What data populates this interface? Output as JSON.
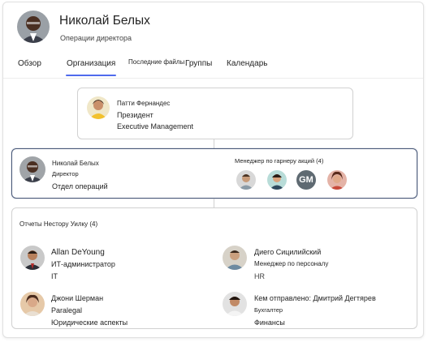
{
  "header": {
    "name": "Николай Белых",
    "subtitle": "Операции директора"
  },
  "tabs": [
    {
      "label": "Обзор"
    },
    {
      "label": "Организация"
    },
    {
      "label": "Последние файлы"
    },
    {
      "label": "Группы"
    },
    {
      "label": "Календарь"
    }
  ],
  "manager": {
    "name": "Патти Фернандес",
    "title": "Президент",
    "department": "Executive Management"
  },
  "current": {
    "name": "Николай Белых",
    "title": "Директор",
    "department": "Отдел операций",
    "peers_heading": "Менеджер по гарнеру акций (4)",
    "peer_initials": "GM"
  },
  "reports": {
    "heading": "Отчеты Нестору Уилку (4)",
    "people": [
      {
        "name": "Allan DeYoung",
        "title": "ИТ-администратор",
        "department": "IT"
      },
      {
        "name": "Диего Сицилийский",
        "title": "Менеджер по персоналу",
        "department": "HR"
      },
      {
        "name": "Джони Шерман",
        "title": "Paralegal",
        "department": "Юридические аспекты"
      },
      {
        "name": "Кем отправлено: Дмитрий Дегтярев",
        "title": "Бухгалтер",
        "department": "Финансы"
      }
    ]
  },
  "colors": {
    "accent": "#4f6bed",
    "selected_border": "#4a5a7a",
    "border": "#d1d1d1",
    "initials_bg": "#5f6a72"
  },
  "icons": {
    "avatars": "person-photo"
  }
}
